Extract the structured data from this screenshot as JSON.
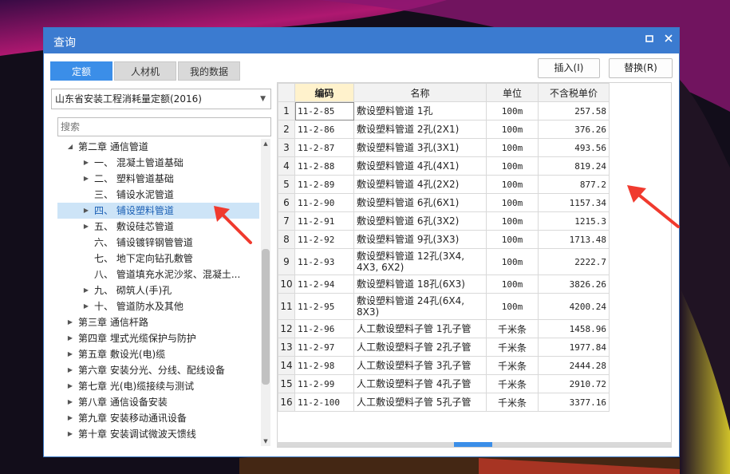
{
  "window": {
    "title": "查询"
  },
  "tabs": [
    {
      "label": "定额",
      "active": true
    },
    {
      "label": "人材机",
      "active": false
    },
    {
      "label": "我的数据",
      "active": false
    }
  ],
  "toolbar": {
    "insert_label": "插入(I)",
    "replace_label": "替换(R)"
  },
  "library_select": {
    "value": "山东省安装工程消耗量定额(2016)"
  },
  "search": {
    "placeholder": "搜索"
  },
  "tree": [
    {
      "label": "第二章 通信管道",
      "level": 1,
      "state": "expanded"
    },
    {
      "label": "一、 混凝土管道基础",
      "level": 2,
      "state": "collapsed"
    },
    {
      "label": "二、 塑料管道基础",
      "level": 2,
      "state": "collapsed"
    },
    {
      "label": "三、 铺设水泥管道",
      "level": 2,
      "state": "leaf"
    },
    {
      "label": "四、 铺设塑料管道",
      "level": 2,
      "state": "collapsed",
      "selected": true
    },
    {
      "label": "五、 敷设硅芯管道",
      "level": 2,
      "state": "collapsed"
    },
    {
      "label": "六、 铺设镀锌钢管管道",
      "level": 2,
      "state": "leaf"
    },
    {
      "label": "七、 地下定向钻孔敷管",
      "level": 2,
      "state": "leaf"
    },
    {
      "label": "八、 管道填充水泥沙浆、混凝土...",
      "level": 2,
      "state": "leaf"
    },
    {
      "label": "九、 砌筑人(手)孔",
      "level": 2,
      "state": "collapsed"
    },
    {
      "label": "十、 管道防水及其他",
      "level": 2,
      "state": "collapsed"
    },
    {
      "label": "第三章 通信杆路",
      "level": 1,
      "state": "collapsed"
    },
    {
      "label": "第四章 埋式光缆保护与防护",
      "level": 1,
      "state": "collapsed"
    },
    {
      "label": "第五章 敷设光(电)缆",
      "level": 1,
      "state": "collapsed"
    },
    {
      "label": "第六章 安装分光、分线、配线设备",
      "level": 1,
      "state": "collapsed"
    },
    {
      "label": "第七章 光(电)缆接续与测试",
      "level": 1,
      "state": "collapsed"
    },
    {
      "label": "第八章 通信设备安装",
      "level": 1,
      "state": "collapsed"
    },
    {
      "label": "第九章 安装移动通讯设备",
      "level": 1,
      "state": "collapsed"
    },
    {
      "label": "第十章 安装调试微波天馈线",
      "level": 1,
      "state": "collapsed"
    }
  ],
  "grid": {
    "headers": {
      "code": "编码",
      "name": "名称",
      "unit": "单位",
      "price": "不含税单价"
    },
    "rows": [
      {
        "n": "1",
        "code": "11-2-85",
        "name": "敷设塑料管道 1孔",
        "unit": "100m",
        "price": "257.58"
      },
      {
        "n": "2",
        "code": "11-2-86",
        "name": "敷设塑料管道 2孔(2X1)",
        "unit": "100m",
        "price": "376.26"
      },
      {
        "n": "3",
        "code": "11-2-87",
        "name": "敷设塑料管道 3孔(3X1)",
        "unit": "100m",
        "price": "493.56"
      },
      {
        "n": "4",
        "code": "11-2-88",
        "name": "敷设塑料管道 4孔(4X1)",
        "unit": "100m",
        "price": "819.24"
      },
      {
        "n": "5",
        "code": "11-2-89",
        "name": "敷设塑料管道 4孔(2X2)",
        "unit": "100m",
        "price": "877.2"
      },
      {
        "n": "6",
        "code": "11-2-90",
        "name": "敷设塑料管道 6孔(6X1)",
        "unit": "100m",
        "price": "1157.34"
      },
      {
        "n": "7",
        "code": "11-2-91",
        "name": "敷设塑料管道 6孔(3X2)",
        "unit": "100m",
        "price": "1215.3"
      },
      {
        "n": "8",
        "code": "11-2-92",
        "name": "敷设塑料管道 9孔(3X3)",
        "unit": "100m",
        "price": "1713.48"
      },
      {
        "n": "9",
        "code": "11-2-93",
        "name": "敷设塑料管道 12孔(3X4, 4X3, 6X2)",
        "unit": "100m",
        "price": "2222.7",
        "tall": true
      },
      {
        "n": "10",
        "code": "11-2-94",
        "name": "敷设塑料管道 18孔(6X3)",
        "unit": "100m",
        "price": "3826.26"
      },
      {
        "n": "11",
        "code": "11-2-95",
        "name": "敷设塑料管道 24孔(6X4, 8X3)",
        "unit": "100m",
        "price": "4200.24",
        "tall": true
      },
      {
        "n": "12",
        "code": "11-2-96",
        "name": "人工敷设塑料子管 1孔子管",
        "unit": "千米条",
        "price": "1458.96"
      },
      {
        "n": "13",
        "code": "11-2-97",
        "name": "人工敷设塑料子管 2孔子管",
        "unit": "千米条",
        "price": "1977.84"
      },
      {
        "n": "14",
        "code": "11-2-98",
        "name": "人工敷设塑料子管 3孔子管",
        "unit": "千米条",
        "price": "2444.28"
      },
      {
        "n": "15",
        "code": "11-2-99",
        "name": "人工敷设塑料子管 4孔子管",
        "unit": "千米条",
        "price": "2910.72"
      },
      {
        "n": "16",
        "code": "11-2-100",
        "name": "人工敷设塑料子管 5孔子管",
        "unit": "千米条",
        "price": "3377.16"
      }
    ]
  },
  "colors": {
    "titlebar": "#3b7bd0",
    "tab_active": "#3b8ee8",
    "selection": "#cde4f7",
    "code_header": "#fff2cc",
    "annotation_arrow": "#f03a2e"
  },
  "icons": {
    "maximize": "restore-square-icon",
    "close": "close-x-icon",
    "expanded": "triangle-down-icon",
    "collapsed": "triangle-right-icon",
    "dropdown": "chevron-down-icon"
  }
}
